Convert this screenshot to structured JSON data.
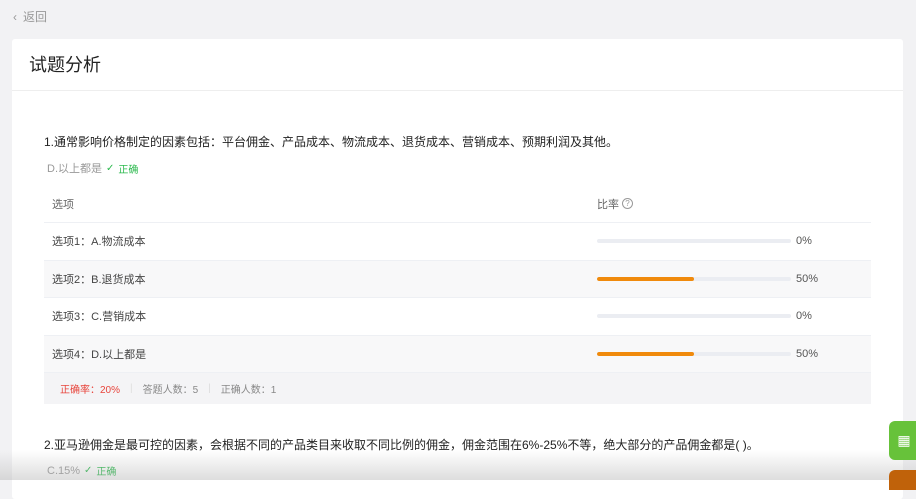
{
  "nav": {
    "back_label": "返回"
  },
  "page_title": "试题分析",
  "questions": [
    {
      "text": "1.通常影响价格制定的因素包括：平台佣金、产品成本、物流成本、退货成本、营销成本、预期利润及其他。",
      "answer": "D.以上都是",
      "answer_status": "正确",
      "table_headers": {
        "option": "选项",
        "rate": "比率"
      },
      "options": [
        {
          "label": "选项1：A.物流成本",
          "percent": 0,
          "percent_label": "0%"
        },
        {
          "label": "选项2：B.退货成本",
          "percent": 50,
          "percent_label": "50%"
        },
        {
          "label": "选项3：C.营销成本",
          "percent": 0,
          "percent_label": "0%"
        },
        {
          "label": "选项4：D.以上都是",
          "percent": 50,
          "percent_label": "50%"
        }
      ],
      "stats": {
        "accuracy": "正确率：20%",
        "answered": "答题人数：5",
        "correct": "正确人数：1"
      }
    },
    {
      "text": "2.亚马逊佣金是最可控的因素，会根据不同的产品类目来收取不同比例的佣金，佣金范围在6%-25%不等，绝大部分的产品佣金都是( )。",
      "answer": "C.15%",
      "answer_status": "正确"
    }
  ],
  "colors": {
    "accent": "#f08a0c",
    "correct": "#2bb94d",
    "error": "#e8453c"
  }
}
